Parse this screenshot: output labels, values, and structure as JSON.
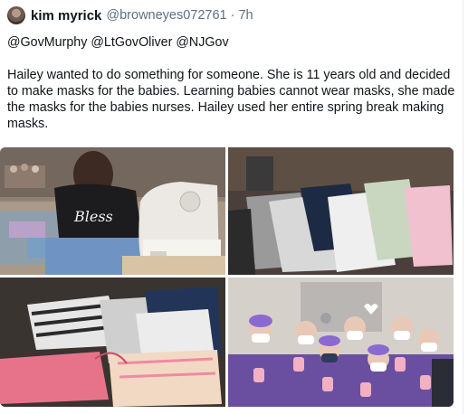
{
  "tweet": {
    "author_name": "kim myrick",
    "handle": "@browneyes072761",
    "separator": "·",
    "time": "7h",
    "mentions": [
      "@GovMurphy",
      "@LtGovOliver",
      "@NJGov"
    ],
    "body": "Hailey wanted to do something for someone.  She is 11 years old and decided to make masks for the babies.  Learning babies cannot wear masks, she made the masks for the babies nurses.  Hailey used her entire spring break making masks.",
    "photos": [
      {
        "name": "girl-sewing-photo",
        "sweater_text": "Bless"
      },
      {
        "name": "folded-masks-photo"
      },
      {
        "name": "masks-on-chair-photo"
      },
      {
        "name": "nurses-group-photo"
      }
    ]
  }
}
